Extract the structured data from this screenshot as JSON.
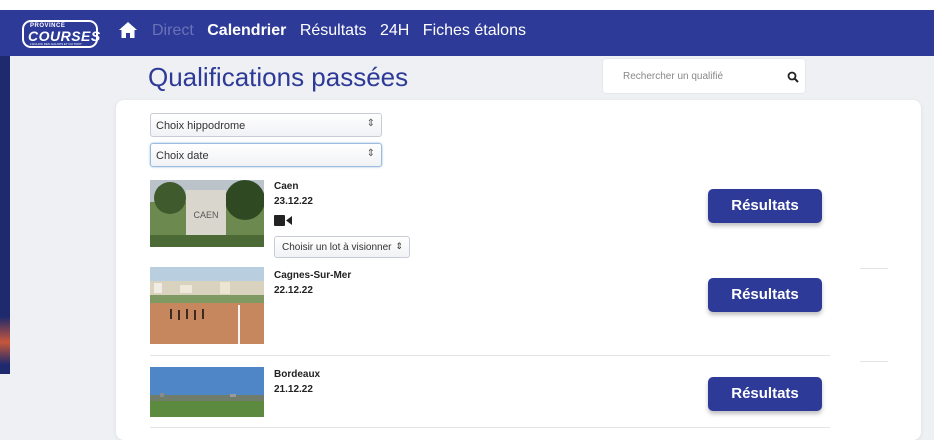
{
  "logo": {
    "line1": "PROVINCE",
    "line2": "COURSES",
    "line3": "L'ECHOS DES GALOPS ET DU TROT"
  },
  "nav": {
    "items": [
      "Direct",
      "Calendrier",
      "Résultats",
      "24H",
      "Fiches étalons"
    ]
  },
  "page": {
    "title": "Qualifications passées"
  },
  "search": {
    "placeholder": "Rechercher un qualifié"
  },
  "filters": {
    "hippodrome": "Choix hippodrome",
    "date": "Choix date"
  },
  "entries": [
    {
      "name": "Caen",
      "date": "23.12.22",
      "lot_select": "Choisir un lot à visionner",
      "button": "Résultats",
      "sign": "CAEN"
    },
    {
      "name": "Cagnes-Sur-Mer",
      "date": "22.12.22",
      "button": "Résultats"
    },
    {
      "name": "Bordeaux",
      "date": "21.12.22",
      "button": "Résultats"
    }
  ]
}
